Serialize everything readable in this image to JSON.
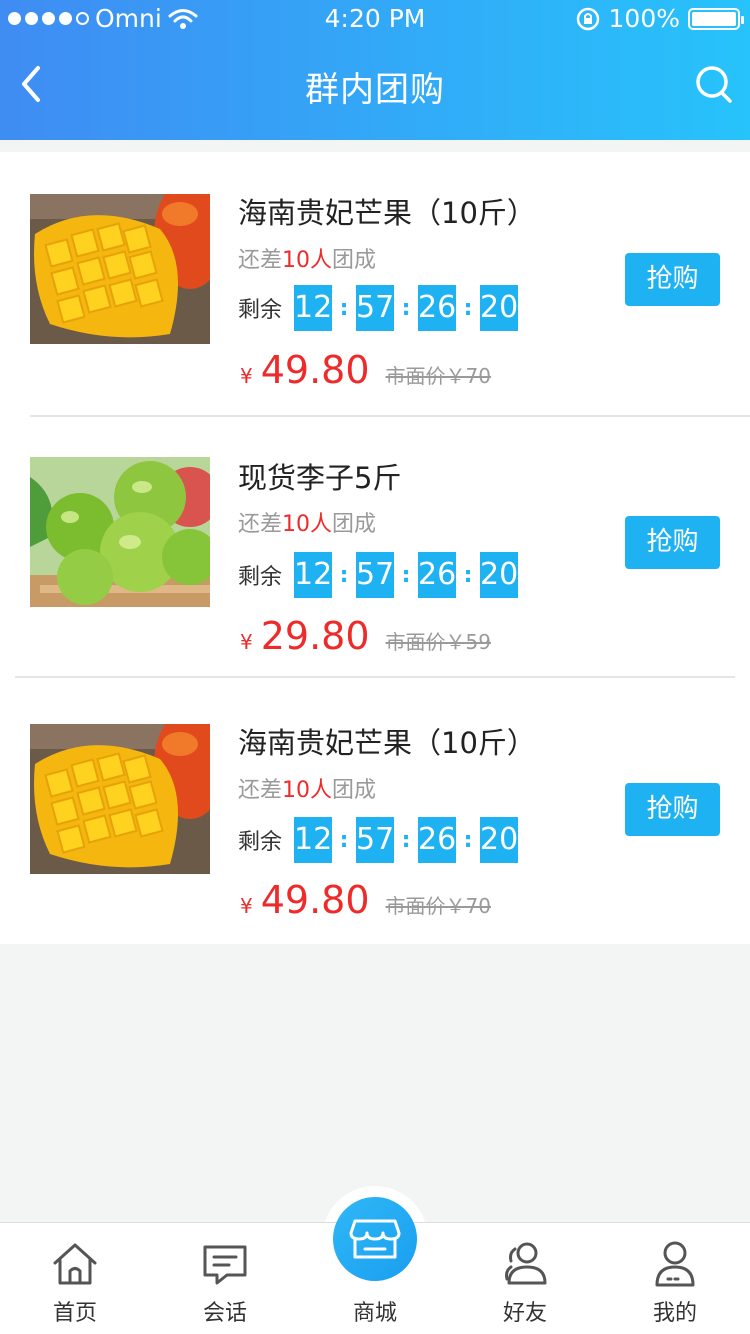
{
  "status_bar": {
    "carrier": "Omni",
    "time": "4:20 PM",
    "battery": "100%"
  },
  "nav": {
    "title": "群内团购"
  },
  "products": [
    {
      "title": "海南贵妃芒果（10斤）",
      "need_prefix": "还差",
      "need_count": "10人",
      "need_suffix": "团成",
      "countdown_label": "剩余",
      "countdown": [
        "12",
        "57",
        "26",
        "20"
      ],
      "currency": "¥",
      "price": "49.80",
      "market_price": "市面价￥70",
      "button": "抢购",
      "image": "mango"
    },
    {
      "title": "现货李子5斤",
      "need_prefix": "还差",
      "need_count": "10人",
      "need_suffix": "团成",
      "countdown_label": "剩余",
      "countdown": [
        "12",
        "57",
        "26",
        "20"
      ],
      "currency": "¥",
      "price": "29.80",
      "market_price": "市面价￥59",
      "button": "抢购",
      "image": "plum"
    },
    {
      "title": "海南贵妃芒果（10斤）",
      "need_prefix": "还差",
      "need_count": "10人",
      "need_suffix": "团成",
      "countdown_label": "剩余",
      "countdown": [
        "12",
        "57",
        "26",
        "20"
      ],
      "currency": "¥",
      "price": "49.80",
      "market_price": "市面价￥70",
      "button": "抢购",
      "image": "mango"
    }
  ],
  "tabbar": {
    "items": [
      {
        "label": "首页",
        "icon": "home-icon"
      },
      {
        "label": "会话",
        "icon": "chat-icon"
      },
      {
        "label": "商城",
        "icon": "store-icon"
      },
      {
        "label": "好友",
        "icon": "friends-icon"
      },
      {
        "label": "我的",
        "icon": "user-icon"
      }
    ]
  },
  "colors": {
    "header_gradient_start": "#3f8cf3",
    "header_gradient_end": "#27c3fb",
    "accent": "#1fb2f2",
    "price": "#ee2b2b"
  }
}
